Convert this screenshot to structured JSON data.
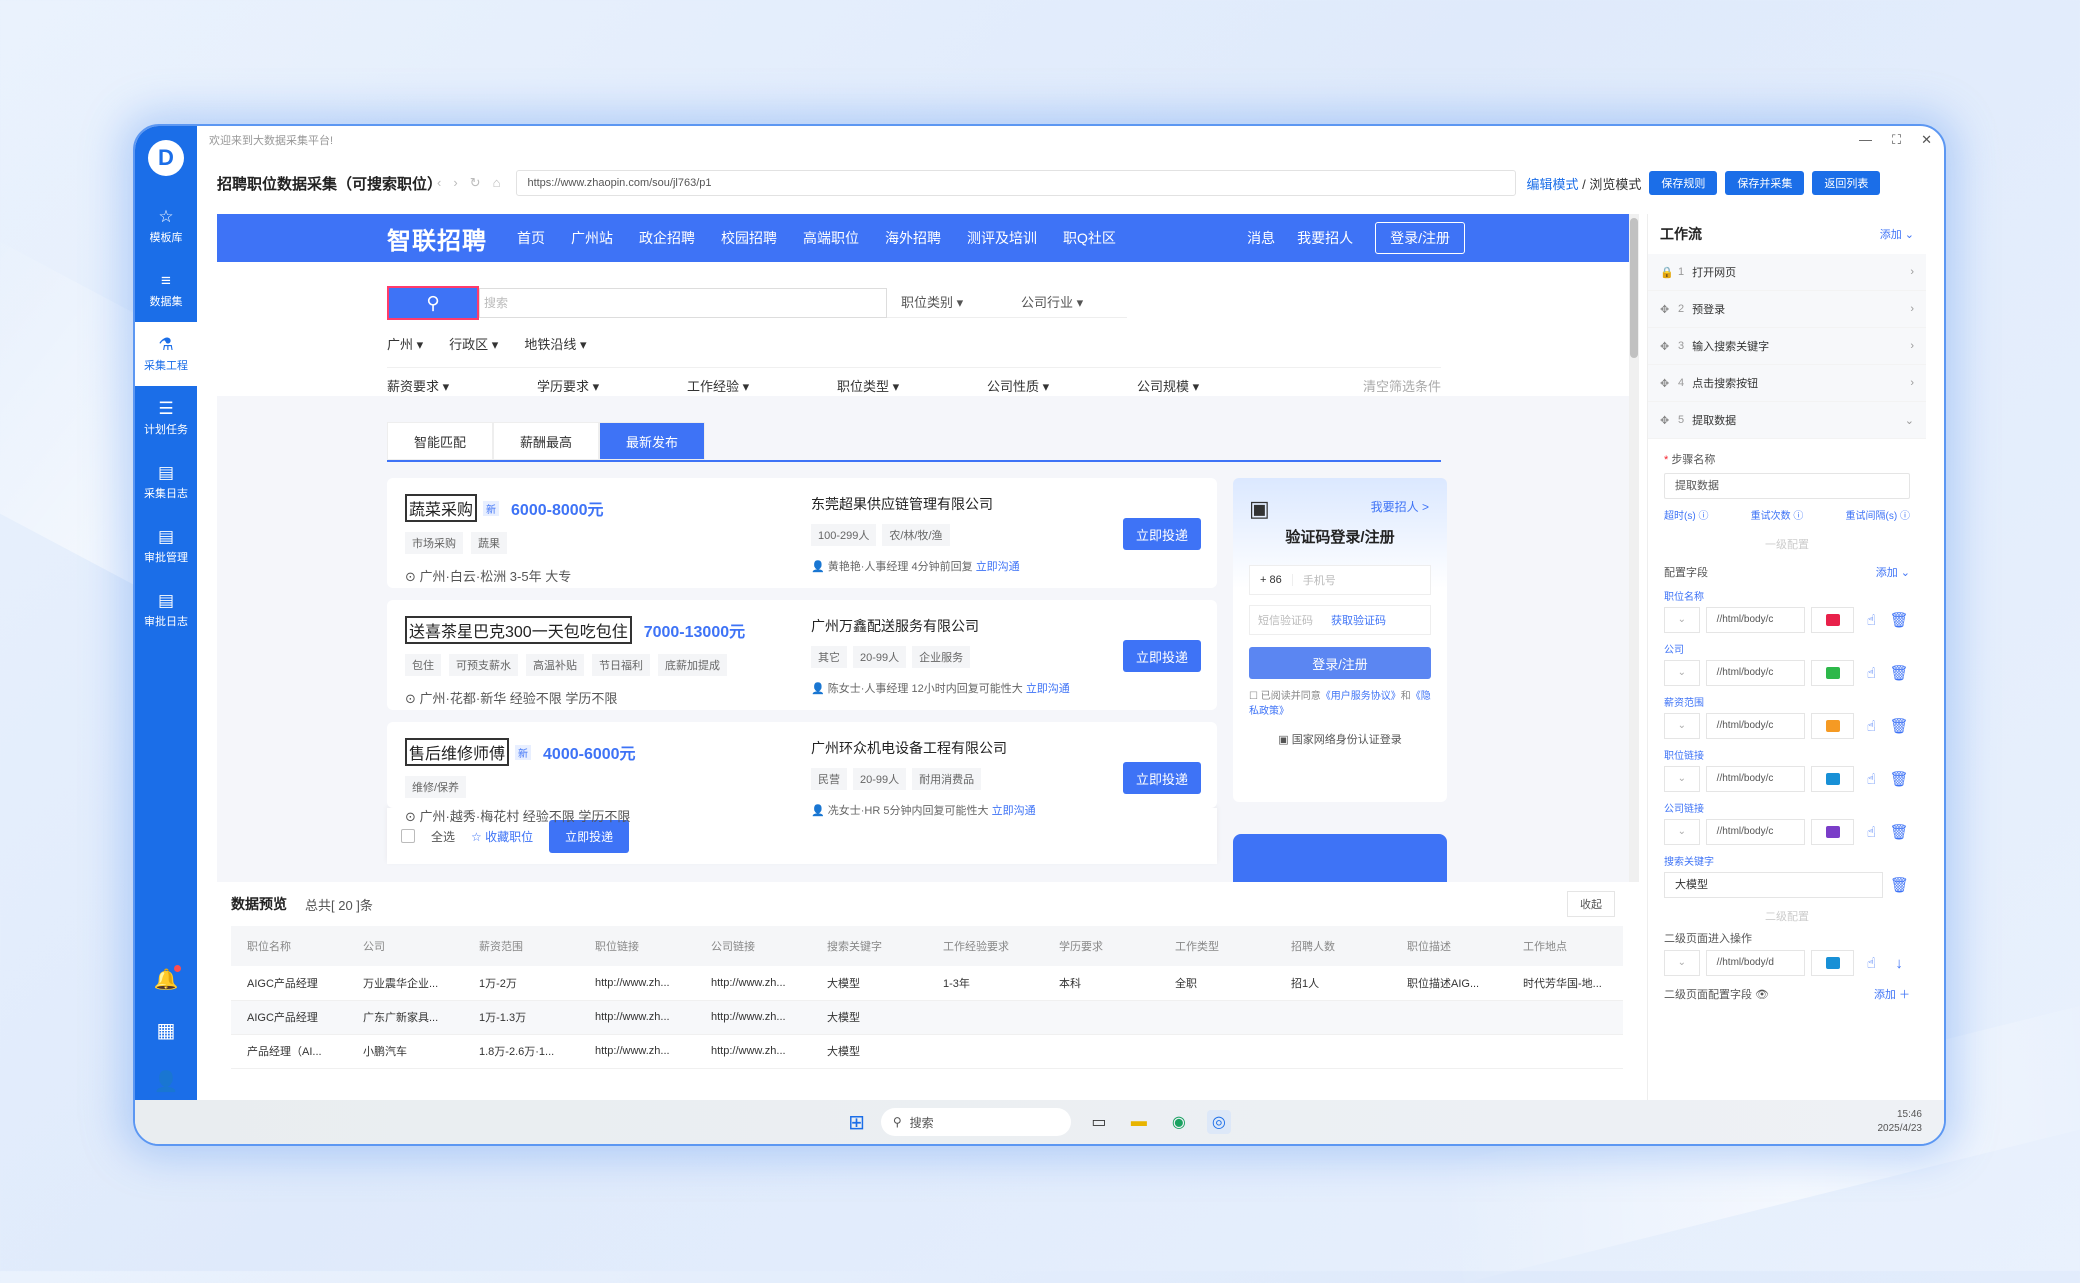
{
  "app": {
    "welcome": "欢迎来到大数据采集平台!",
    "page_title": "招聘职位数据采集（可搜索职位）",
    "url": "https://www.zhaopin.com/sou/jl763/p1",
    "mode_edit": "编辑模式",
    "mode_sep": " / ",
    "mode_browse": "浏览模式",
    "btn_save_rule": "保存规则",
    "btn_save_collect": "保存并采集",
    "btn_back": "返回列表"
  },
  "nav": [
    {
      "icon": "☆",
      "label": "模板库"
    },
    {
      "icon": "≡",
      "label": "数据集"
    },
    {
      "icon": "⚗",
      "label": "采集工程"
    },
    {
      "icon": "☰",
      "label": "计划任务"
    },
    {
      "icon": "▤",
      "label": "采集日志"
    },
    {
      "icon": "▤",
      "label": "审批管理"
    },
    {
      "icon": "▤",
      "label": "审批日志"
    }
  ],
  "site": {
    "logo": "智联招聘",
    "nav": [
      "首页",
      "广州站",
      "政企招聘",
      "校园招聘",
      "高端职位",
      "海外招聘",
      "测评及培训",
      "职Q社区"
    ],
    "msg": "消息",
    "hire": "我要招人",
    "login": "登录/注册",
    "search_placeholder": "搜索",
    "sel_job": "职位类别",
    "sel_industry": "公司行业",
    "filters1": [
      "广州",
      "行政区",
      "地铁沿线"
    ],
    "filters2": [
      "薪资要求",
      "学历要求",
      "工作经验",
      "职位类型",
      "公司性质",
      "公司规模"
    ],
    "clear": "清空筛选条件",
    "tabs": [
      "智能匹配",
      "薪酬最高",
      "最新发布"
    ]
  },
  "jobs": [
    {
      "name": "蔬菜采购",
      "new": "新",
      "salary": "6000-8000元",
      "tags": [
        "市场采购",
        "蔬果"
      ],
      "loc": "广州·白云·松洲  3-5年  大专",
      "company": "东莞超果供应链管理有限公司",
      "cinfo": [
        "100-299人",
        "农/林/牧/渔"
      ],
      "hr": "黄艳艳·人事经理",
      "time": "4分钟前回复",
      "chat": "立即沟通",
      "apply": "立即投递"
    },
    {
      "name": "送喜茶星巴克300一天包吃包住",
      "new": "",
      "salary": "7000-13000元",
      "tags": [
        "包住",
        "可预支薪水",
        "高温补贴",
        "节日福利",
        "底薪加提成"
      ],
      "loc": "广州·花都·新华  经验不限  学历不限",
      "company": "广州万鑫配送服务有限公司",
      "cinfo": [
        "其它",
        "20-99人",
        "企业服务"
      ],
      "hr": "陈女士·人事经理",
      "time": "12小时内回复可能性大",
      "chat": "立即沟通",
      "apply": "立即投递"
    },
    {
      "name": "售后维修师傅",
      "new": "新",
      "salary": "4000-6000元",
      "tags": [
        "维修/保养"
      ],
      "loc": "广州·越秀·梅花村  经验不限  学历不限",
      "company": "广州环众机电设备工程有限公司",
      "cinfo": [
        "民营",
        "20-99人",
        "耐用消费品"
      ],
      "hr": "冼女士·HR",
      "time": "5分钟内回复可能性大",
      "chat": "立即沟通",
      "apply": "立即投递"
    }
  ],
  "bulk": {
    "all": "全选",
    "fav": "收藏职位",
    "apply": "立即投递"
  },
  "login": {
    "hire": "我要招人 >",
    "title": "验证码登录/注册",
    "cc": "+ 86",
    "phone": "手机号",
    "code": "短信验证码",
    "get": "获取验证码",
    "btn": "登录/注册",
    "agree1": "已阅读并同意",
    "agree2": "《用户服务协议》",
    "agree3": "和",
    "agree4": "《隐私政策》",
    "id": "国家网络身份认证登录"
  },
  "preview": {
    "title": "数据预览",
    "count": "总共[ 20 ]条",
    "collapse": "收起",
    "cols": [
      "职位名称",
      "公司",
      "薪资范围",
      "职位链接",
      "公司链接",
      "搜索关键字",
      "工作经验要求",
      "学历要求",
      "工作类型",
      "招聘人数",
      "职位描述",
      "工作地点"
    ],
    "rows": [
      [
        "AIGC产品经理",
        "万业震华企业...",
        "1万-2万",
        "http://www.zh...",
        "http://www.zh...",
        "大模型",
        "1-3年",
        "本科",
        "全职",
        "招1人",
        "职位描述AIG...",
        "时代芳华国-地..."
      ],
      [
        "AIGC产品经理",
        "广东广新家具...",
        "1万-1.3万",
        "http://www.zh...",
        "http://www.zh...",
        "大模型",
        "",
        "",
        "",
        "",
        "",
        ""
      ],
      [
        "产品经理（AI...",
        "小鹏汽车",
        "1.8万-2.6万·1...",
        "http://www.zh...",
        "http://www.zh...",
        "大模型",
        "",
        "",
        "",
        "",
        "",
        ""
      ]
    ]
  },
  "wf": {
    "title": "工作流",
    "add": "添加 ⌄",
    "steps": [
      {
        "icon": "🔒",
        "num": "1",
        "label": "打开网页",
        "arr": "›"
      },
      {
        "icon": "✥",
        "num": "2",
        "label": "预登录",
        "arr": "›"
      },
      {
        "icon": "✥",
        "num": "3",
        "label": "输入搜索关键字",
        "arr": "›"
      },
      {
        "icon": "✥",
        "num": "4",
        "label": "点击搜索按钮",
        "arr": "›"
      },
      {
        "icon": "✥",
        "num": "5",
        "label": "提取数据",
        "arr": "⌄"
      }
    ],
    "step_name_label": "步骤名称",
    "step_name": "提取数据",
    "opt1": "超时(s) ⓘ",
    "opt2": "重试次数 ⓘ",
    "opt3": "重试间隔(s) ⓘ",
    "sec1": "一级配置",
    "field_cfg": "配置字段",
    "field_add": "添加 ⌄",
    "fields": [
      {
        "name": "职位名称",
        "xpath": "//html/body/c",
        "color": "#e8214a"
      },
      {
        "name": "公司",
        "xpath": "//html/body/c",
        "color": "#2db84a"
      },
      {
        "name": "薪资范围",
        "xpath": "//html/body/c",
        "color": "#f59a23"
      },
      {
        "name": "职位链接",
        "xpath": "//html/body/c",
        "color": "#1890d6"
      },
      {
        "name": "公司链接",
        "xpath": "//html/body/c",
        "color": "#7a3dc8"
      }
    ],
    "kw_label": "搜索关键字",
    "kw": "大模型",
    "sec2": "二级配置",
    "sub_enter": "二级页面进入操作",
    "sub_xpath": "//html/body/d",
    "sub_color": "#1890d6",
    "sub_fields": "二级页面配置字段 👁",
    "sub_add": "添加 ＋"
  },
  "taskbar": {
    "search": "搜索",
    "time": "15:46",
    "date": "2025/4/23"
  }
}
